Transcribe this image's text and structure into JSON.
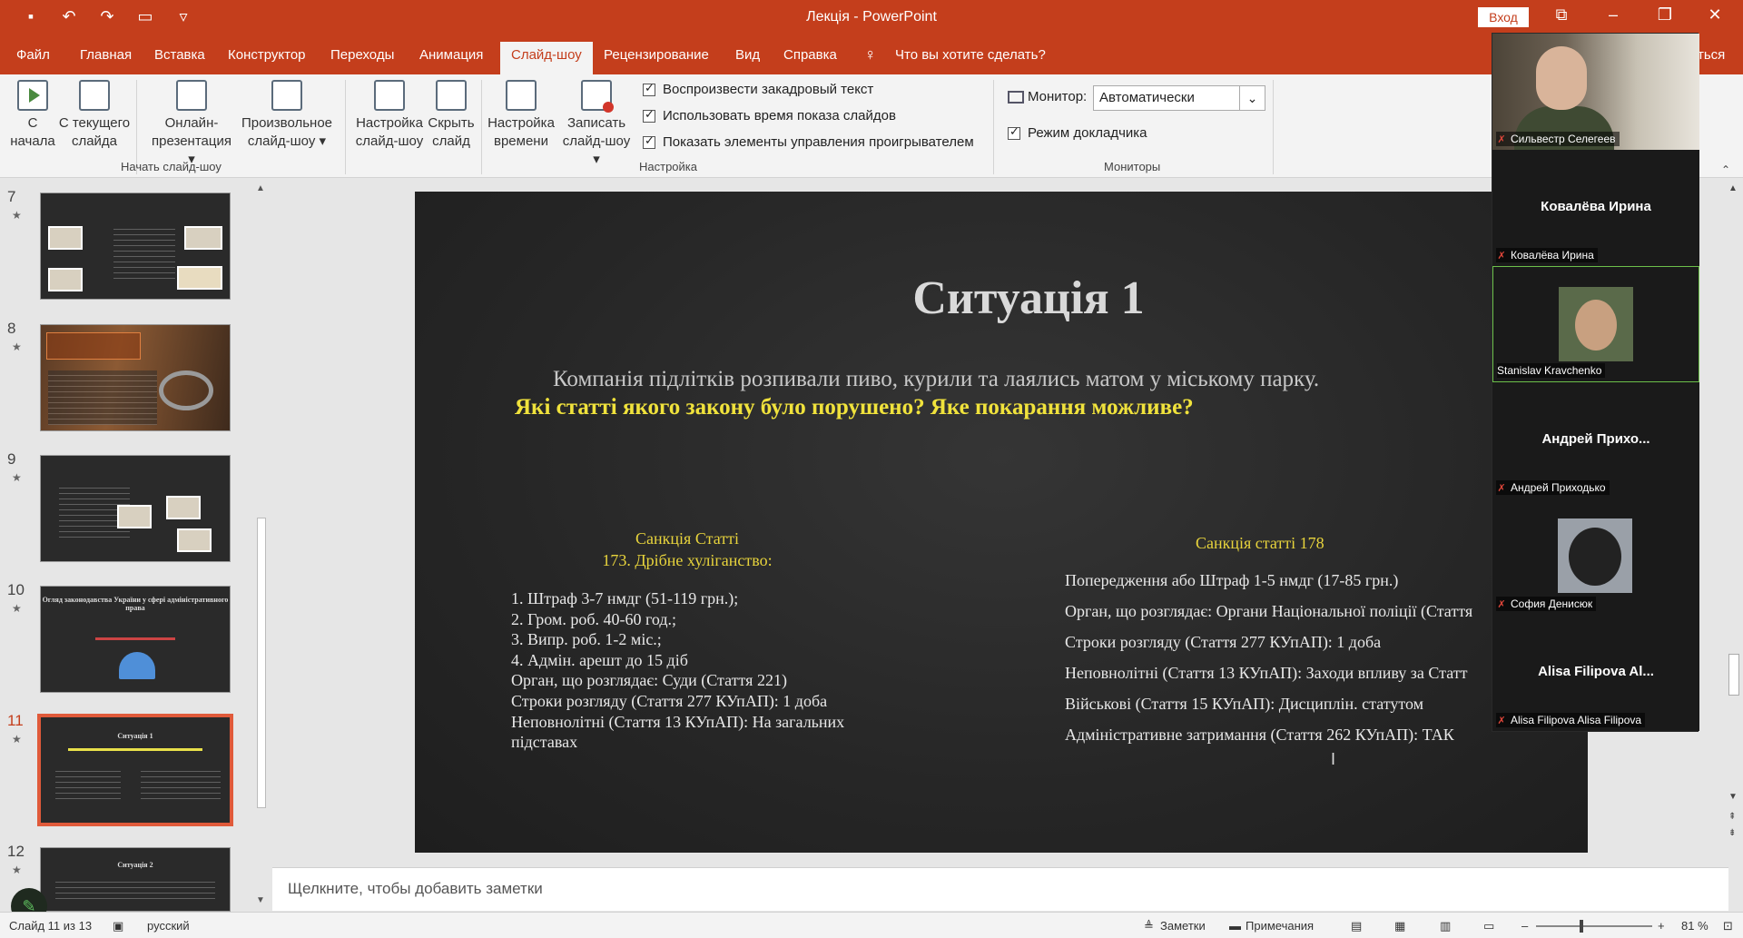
{
  "app": {
    "title": "Лекція  -  PowerPoint",
    "signin": "Вход",
    "qat_icons": [
      "save-icon",
      "undo-icon",
      "redo-icon",
      "present-icon",
      "customize-icon"
    ]
  },
  "tabs": [
    {
      "label": "Файл"
    },
    {
      "label": "Главная"
    },
    {
      "label": "Вставка"
    },
    {
      "label": "Конструктор"
    },
    {
      "label": "Переходы"
    },
    {
      "label": "Анимация"
    },
    {
      "label": "Слайд-шоу",
      "active": true
    },
    {
      "label": "Рецензирование"
    },
    {
      "label": "Вид"
    },
    {
      "label": "Справка"
    }
  ],
  "tellme": "Что вы хотите сделать?",
  "tab_overflow": "ться",
  "ribbon": {
    "start_group": {
      "label": "Начать слайд-шоу",
      "from_start": "С начала",
      "from_start_l1": "С",
      "from_start_l2": "начала",
      "from_current_l1": "С текущего",
      "from_current_l2": "слайда",
      "online_l1": "Онлайн-",
      "online_l2": "презентация ▾",
      "custom_l1": "Произвольное",
      "custom_l2": "слайд-шоу ▾"
    },
    "setup_group": {
      "label": "Настройка",
      "setup_l1": "Настройка",
      "setup_l2": "слайд-шоу",
      "hide_l1": "Скрыть",
      "hide_l2": "слайд",
      "timing_l1": "Настройка",
      "timing_l2": "времени",
      "record_l1": "Записать",
      "record_l2": "слайд-шоу ▾",
      "check_narration": "Воспроизвести закадровый текст",
      "check_timings": "Использовать время показа слайдов",
      "check_controls": "Показать элементы управления проигрывателем"
    },
    "monitors_group": {
      "label": "Мониторы",
      "monitor_label": "Монитор:",
      "monitor_value": "Автоматически",
      "presenter_view": "Режим докладчика"
    }
  },
  "thumbnails": [
    {
      "num": "7",
      "title": ""
    },
    {
      "num": "8",
      "title": ""
    },
    {
      "num": "9",
      "title": ""
    },
    {
      "num": "10",
      "title": "Огляд законодавства України у сфері адміністративного права"
    },
    {
      "num": "11",
      "title": "Ситуація 1",
      "selected": true
    },
    {
      "num": "12",
      "title": "Ситуація 2"
    }
  ],
  "slide": {
    "title": "Ситуація 1",
    "subtitle": "Компанія підлітків розпивали пиво, курили та  лаялись матом у міському парку.",
    "question": "Які статті якого закону було порушено? Яке покарання можливе?",
    "left_heading_1": "Санкція Статті",
    "left_heading_2": "173. Дрібне хуліганство:",
    "left_items": [
      " 1. Штраф 3-7 нмдг (51-119 грн.);",
      "2. Гром. роб. 40-60 год.;",
      "3. Випр. роб. 1-2 міс.;",
      "4. Адмін. арешт до 15 діб",
      "Орган, що розглядає: Суди (Стаття 221)",
      "Строки розгляду (Стаття 277 КУпАП): 1 доба",
      "Неповнолітні (Стаття 13 КУпАП): На загальних",
      "підставах"
    ],
    "right_heading": "Санкція статті 178",
    "right_items": [
      "Попередження або Штраф 1-5 нмдг (17-85 грн.)",
      "Орган, що розглядає: Органи Національної поліції (Стаття",
      "Строки розгляду (Стаття 277 КУпАП): 1 доба",
      "Неповнолітні (Стаття 13 КУпАП): Заходи впливу за Статт",
      "Військові (Стаття 15 КУпАП): Дисциплін. статутом",
      "Адміністративне затримання (Стаття 262 КУпАП): ТАК"
    ]
  },
  "notes_placeholder": "Щелкните, чтобы добавить заметки",
  "status": {
    "slide": "Слайд 11 из 13",
    "language": "русский",
    "notes": "Заметки",
    "comments": "Примечания",
    "zoom": "81 %"
  },
  "participants": [
    {
      "name": "Сильвестр Селегеев",
      "video": true,
      "muted": true
    },
    {
      "display": "Ковалёва Ирина",
      "name": "Ковалёва Ирина",
      "muted": true
    },
    {
      "name": "Stanislav Kravchenko",
      "avatar": true,
      "active": true
    },
    {
      "display": "Андрей  Прихо...",
      "name": "Андрей Приходько",
      "muted": true
    },
    {
      "name": "София Денисюк",
      "avatar": true,
      "muted": true
    },
    {
      "display": "Alisa Filipova Al...",
      "name": "Alisa Filipova Alisa Filipova",
      "muted": true
    }
  ],
  "colors": {
    "accent": "#c43e1c",
    "slide_bg": "#262626",
    "slide_highlight": "#f0e23c",
    "selected_thumb": "#e05a3a",
    "active_speaker": "#6cc04a"
  }
}
